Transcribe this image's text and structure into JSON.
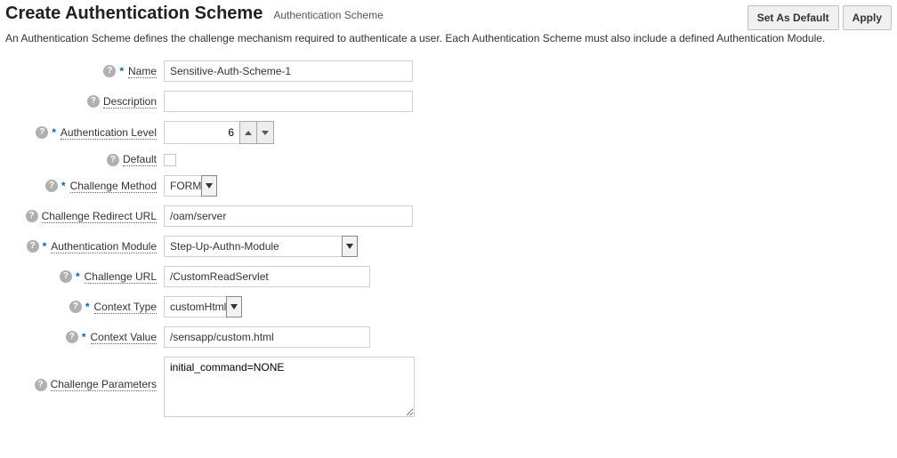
{
  "header": {
    "title": "Create Authentication Scheme",
    "subtitle": "Authentication Scheme",
    "set_default_label": "Set As Default",
    "apply_label": "Apply"
  },
  "description": "An Authentication Scheme defines the challenge mechanism required to authenticate a user. Each Authentication Scheme must also include a defined Authentication Module.",
  "fields": {
    "name": {
      "label": "Name",
      "value": "Sensitive-Auth-Scheme-1",
      "required": true
    },
    "desc": {
      "label": "Description",
      "value": "",
      "required": false
    },
    "auth_level": {
      "label": "Authentication Level",
      "value": "6",
      "required": true
    },
    "default": {
      "label": "Default",
      "checked": false,
      "required": false
    },
    "challenge_method": {
      "label": "Challenge Method",
      "value": "FORM",
      "required": true
    },
    "challenge_redirect_url": {
      "label": "Challenge Redirect URL",
      "value": "/oam/server",
      "required": false
    },
    "auth_module": {
      "label": "Authentication Module",
      "value": "Step-Up-Authn-Module",
      "required": true
    },
    "challenge_url": {
      "label": "Challenge URL",
      "value": "/CustomReadServlet",
      "required": true
    },
    "context_type": {
      "label": "Context Type",
      "value": "customHtml",
      "required": true
    },
    "context_value": {
      "label": "Context Value",
      "value": "/sensapp/custom.html",
      "required": true
    },
    "challenge_params": {
      "label": "Challenge Parameters",
      "value": "initial_command=NONE",
      "required": false
    }
  }
}
